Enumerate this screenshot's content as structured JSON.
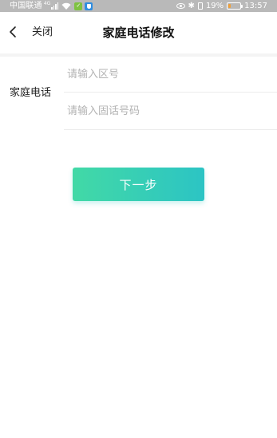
{
  "status_bar": {
    "carrier": "中国联通",
    "network": "4G",
    "battery_text": "19%",
    "battery_level": 0.19,
    "battery_color": "#f0a03a",
    "time": "13:57",
    "icons": [
      "signal-icon",
      "wifi-icon",
      "app-notification-icon",
      "shield-app-icon",
      "eye-icon",
      "bluetooth-icon",
      "vibrate-icon",
      "battery-icon"
    ]
  },
  "nav": {
    "back_icon": "chevron-left-icon",
    "close_label": "关闭",
    "title": "家庭电话修改"
  },
  "form": {
    "label": "家庭电话",
    "area_code_placeholder": "请输入区号",
    "area_code_value": "",
    "number_placeholder": "请输入固话号码",
    "number_value": ""
  },
  "actions": {
    "next_label": "下一步",
    "gradient_start": "#42d9a6",
    "gradient_end": "#2cc4c4"
  }
}
